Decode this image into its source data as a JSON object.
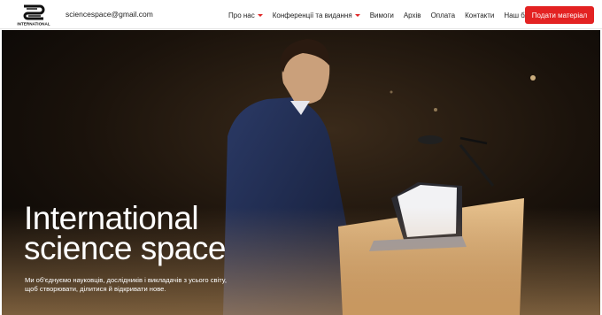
{
  "header": {
    "logo_text": "INTERNATIONAL",
    "email": "sciencespace@gmail.com",
    "nav": [
      {
        "label": "Про нас",
        "has_dropdown": true
      },
      {
        "label": "Конференції та видання",
        "has_dropdown": true
      },
      {
        "label": "Вимоги",
        "has_dropdown": false
      },
      {
        "label": "Архів",
        "has_dropdown": false
      },
      {
        "label": "Оплата",
        "has_dropdown": false
      },
      {
        "label": "Контакти",
        "has_dropdown": false
      },
      {
        "label": "Наш блог",
        "has_dropdown": false
      }
    ],
    "cta_label": "Подати матеріал"
  },
  "hero": {
    "title_line1": "International",
    "title_line2": "science space",
    "subtitle": "Ми об'єднуємо науковців, дослідників і викладачів з усього світу, щоб створювати, ділитися й відкривати нове."
  },
  "colors": {
    "accent": "#e32222",
    "caret": "#e02424",
    "hero_text": "#ffffff"
  }
}
